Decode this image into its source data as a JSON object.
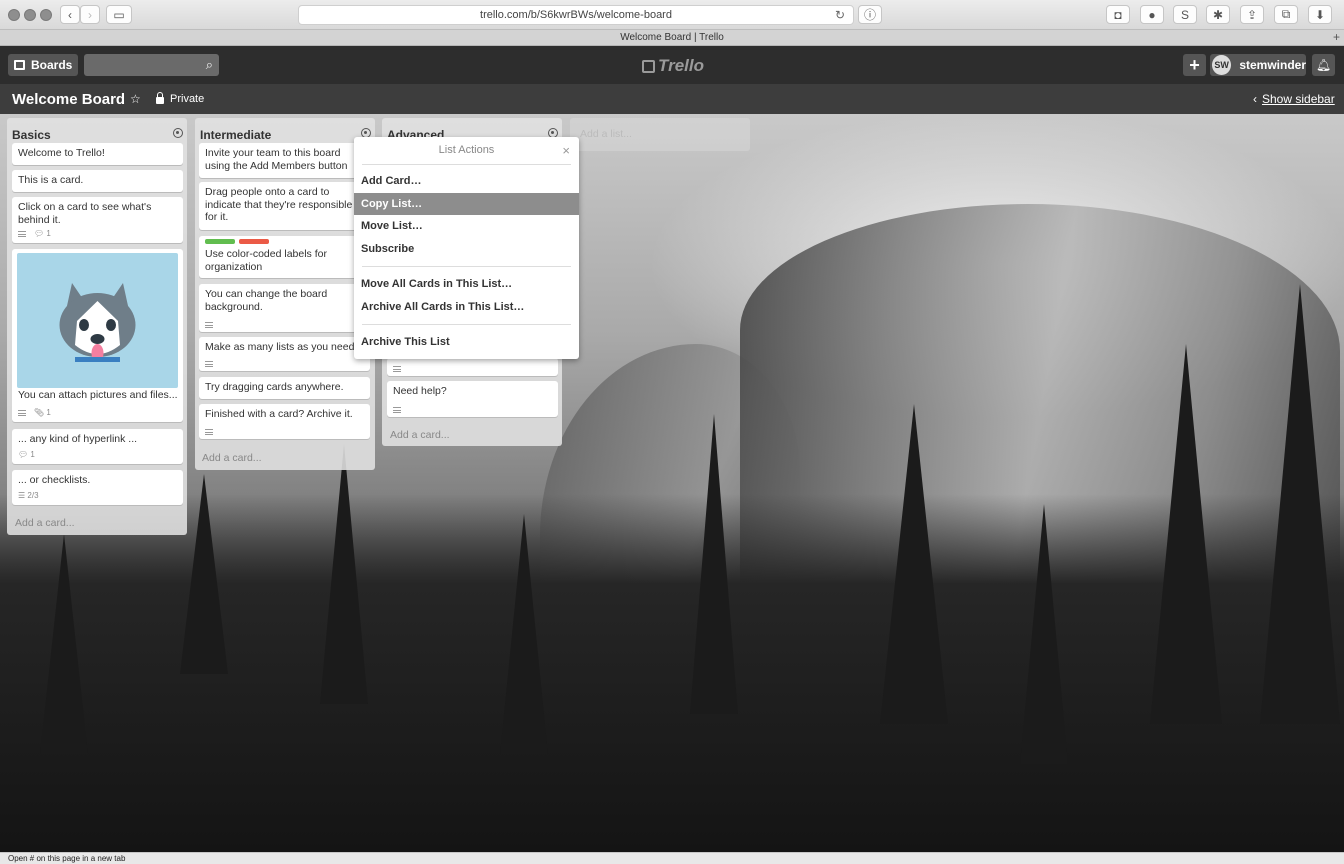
{
  "browser": {
    "url": "trello.com/b/S6kwrBWs/welcome-board",
    "tab_title": "Welcome Board | Trello",
    "status_text": "Open # on this page in a new tab"
  },
  "header": {
    "boards_label": "Boards",
    "search_placeholder": "",
    "logo_text": "Trello",
    "avatar_initials": "SW",
    "username": "stemwinder"
  },
  "board": {
    "title": "Welcome Board",
    "privacy": "Private",
    "show_sidebar": "Show sidebar",
    "add_list_placeholder": "Add a list..."
  },
  "lists": {
    "basics": {
      "title": "Basics",
      "cards": [
        "Welcome to Trello!",
        "This is a card.",
        "Click on a card to see what's behind it.",
        "You can attach pictures and files...",
        "... any kind of hyperlink ...",
        "... or checklists."
      ],
      "badges": {
        "comments_2": "1",
        "attachments_3": "1",
        "comments_4": "1",
        "checklist_5": "2/3"
      },
      "add_card": "Add a card..."
    },
    "intermediate": {
      "title": "Intermediate",
      "cards": [
        "Invite your team to this board using the Add Members button",
        "Drag people onto a card to indicate that they're responsible for it.",
        "Use color-coded labels for organization",
        "You can change the board background.",
        "Make as many lists as you need!",
        "Try dragging cards anywhere.",
        "Finished with a card? Archive it."
      ],
      "add_card": "Add a card..."
    },
    "advanced": {
      "title": "Advanced",
      "cards": [
        "Need help?"
      ],
      "add_card": "Add a card..."
    }
  },
  "list_actions": {
    "title": "List Actions",
    "close": "×",
    "items": [
      "Add Card…",
      "Copy List…",
      "Move List…",
      "Subscribe",
      "Move All Cards in This List…",
      "Archive All Cards in This List…",
      "Archive This List"
    ],
    "highlighted_item": "Copy List…"
  },
  "colors": {
    "label_green": "#61bd4f",
    "label_red": "#eb5a46",
    "header_bg": "#2d2d2d",
    "highlight": "#8d8d8d"
  }
}
